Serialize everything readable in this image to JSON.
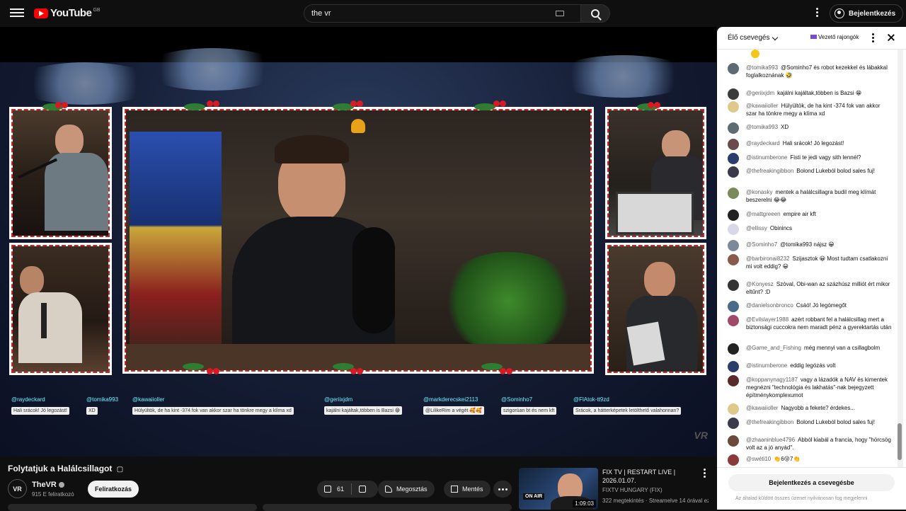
{
  "header": {
    "logo_text": "YouTube",
    "region": "GB",
    "search_value": "the vr",
    "signin_label": "Bejelentkezés"
  },
  "video": {
    "title": "Folytatjuk a Halálcsillagot",
    "title_badge": "▢",
    "channel": "TheVR",
    "subscribers": "915 E feliratkozó",
    "subscribe_label": "Feliratkozás",
    "likes": "61",
    "share_label": "Megosztás",
    "save_label": "Mentés",
    "watermark": "VR",
    "overlay_chat": [
      {
        "name": "@raydeckard",
        "msg": "Hali srácok! Jó legozást!"
      },
      {
        "name": "@tomika993",
        "msg": "XD"
      },
      {
        "name": "@kawaiioller",
        "msg": "Hülyültök, de ha kint -374 fok van akkor szar ha tönkre megy a klíma xd"
      },
      {
        "name": "@geriixjdm",
        "msg": "kajálni kajáltak,többen is Bazsi 😁"
      },
      {
        "name": "@markderecskei2113",
        "msg": "@LilikeRim a végét 🥰🥰"
      },
      {
        "name": "@Sominho7",
        "msg": "szigorúan bt és nem kft"
      },
      {
        "name": "@FlAtok-tt9zd",
        "msg": "Srácok, a hátterképetek letölthető valahonnan?"
      }
    ]
  },
  "recommended": {
    "title": "FIX TV | RESTART LIVE | 2026.01.07.",
    "channel": "FIXTV HUNGARY (FIX)",
    "meta": "322 megtekintés · Streamelve 14 órával ezelőtt",
    "live_badge": "ON AIR",
    "duration": "1:09:03"
  },
  "chat": {
    "title": "Élő csevegés",
    "top_fans_label": "Vezető rajongók",
    "signin_label": "Bejelentkezés a csevegésbe",
    "notice": "Az általad küldött összes üzenet nyilvánosan fog megjelenni",
    "messages": [
      {
        "author": "@tomika993",
        "text": "@Sominho7 és robot kezekkel és lábakkal foglalkoznának 🤣",
        "color": "#5f6b73"
      },
      {
        "author": "@geriixjdm",
        "text": "kajálni kajáltak,többen is Bazsi 😁",
        "color": "#3b3b3b"
      },
      {
        "author": "@kawaiioller",
        "text": "Hülyültök, de ha kint -374 fok van akkor szar ha tönkre megy a klíma xd",
        "color": "#e0c88a"
      },
      {
        "author": "@tomika993",
        "text": "XD",
        "color": "#5f6b73"
      },
      {
        "author": "@raydeckard",
        "text": "Hali srácok! Jó legozást!",
        "color": "#6a4a4a"
      },
      {
        "author": "@istinumberone",
        "text": "Fisti te jedi vagy sith lennél?",
        "color": "#2b3d6b"
      },
      {
        "author": "@thefreakingibbon",
        "text": "Bolond Lukeból bolod sales fuj!",
        "color": "#3a3a4a"
      },
      {
        "author": "@konasky",
        "text": "mentek a halálcsillagra budil meg klímát beszerelni 😂😂",
        "color": "#7a8a5a"
      },
      {
        "author": "@mattgreeen",
        "text": "empire air kft",
        "color": "#222"
      },
      {
        "author": "@ellissy",
        "text": "Obinincs",
        "color": "#d8d8e8"
      },
      {
        "author": "@Sominho7",
        "text": "@tomika993 nájsz 😀",
        "color": "#7a8a9a"
      },
      {
        "author": "@barbironai8232",
        "text": "Szijasztok 😀 Most tudtam csatlakozni mi volt eddig? 😀",
        "color": "#8a5a4a"
      },
      {
        "author": "@Konyesz",
        "text": "Szóval, Obi-wan az százhúsz milliót ért mikor eltűnt? :D",
        "color": "#333"
      },
      {
        "author": "@danielsonbronco",
        "text": "Csáó! Jó legómegőt",
        "color": "#4a6a8a"
      },
      {
        "author": "@Evilslayer1988",
        "text": "azért robbant fel a halálcsillag mert a biztonsági cuccokra nem maradt pénz a gyerektartás után",
        "color": "#a04a6a"
      },
      {
        "author": "@Game_and_Fishing",
        "text": "még mennyi van a csillagbolm",
        "color": "#222"
      },
      {
        "author": "@istinumberone",
        "text": "eddig legózás volt",
        "color": "#2b3d6b"
      },
      {
        "author": "@koppanynagy1187",
        "text": "vagy a lázadók a NAV és kimentek megnézni \"technológia és lakhatás\"-nak bejegyzett építménykomplexumot",
        "color": "#5a2a2a"
      },
      {
        "author": "@kawaiioller",
        "text": "Nagyobb a fekete? érdekes...",
        "color": "#e0c88a"
      },
      {
        "author": "@thefreakingibbon",
        "text": "Bolond Lukeból bolod sales fuj!",
        "color": "#3a3a4a"
      },
      {
        "author": "@zhaaninblue4796",
        "text": "Abból kiabál a francia, hogy \"hörcsög volt az a jó anyád\".",
        "color": "#6a4a3a"
      },
      {
        "author": "@swéti10",
        "text": "👏6😜7👏",
        "color": "#8a3a3a"
      }
    ]
  }
}
